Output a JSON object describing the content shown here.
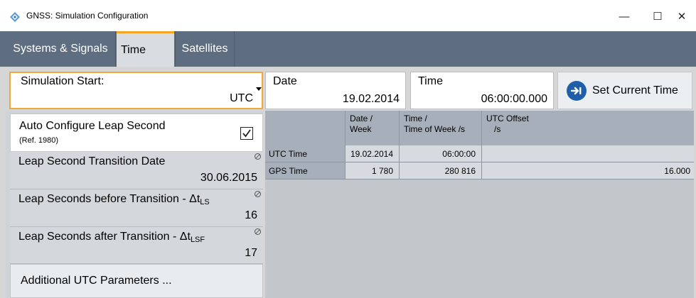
{
  "window": {
    "title": "GNSS: Simulation Configuration",
    "controls": {
      "minimize": "—",
      "maximize": "☐",
      "close": "✕"
    }
  },
  "tabs": [
    {
      "label": "Systems & Signals",
      "active": false
    },
    {
      "label": "Time",
      "active": true
    },
    {
      "label": "Satellites",
      "active": false
    }
  ],
  "simulation_start": {
    "label": "Simulation Start:",
    "value": "UTC"
  },
  "date": {
    "label": "Date",
    "value": "19.02.2014"
  },
  "time": {
    "label": "Time",
    "value": "06:00:00.000"
  },
  "set_current_time": {
    "label": "Set Current Time",
    "icon": "arrow-right-circle-icon"
  },
  "auto_configure": {
    "label": "Auto Configure Leap Second",
    "ref": "(Ref. 1980)",
    "checked": true
  },
  "leap_transition_date": {
    "label": "Leap Second Transition Date",
    "value": "30.06.2015"
  },
  "leap_before": {
    "label": "Leap Seconds before Transition - Δt",
    "sub": "LS",
    "value": "16"
  },
  "leap_after": {
    "label": "Leap Seconds after Transition - Δt",
    "sub": "LSF",
    "value": "17"
  },
  "additional_utc": {
    "label": "Additional UTC Parameters ..."
  },
  "table": {
    "headers": {
      "date_line1": "Date /",
      "date_line2": "Week",
      "time_line1": "Time /",
      "time_line2": "Time of Week /s",
      "utc_line1": "UTC Offset",
      "utc_line2": "/s"
    },
    "rows": [
      {
        "name": "UTC Time",
        "date": "19.02.2014",
        "time": "06:00:00",
        "utc": ""
      },
      {
        "name": "GPS Time",
        "date": "1 780",
        "time": "280 816",
        "utc": "16.000"
      }
    ]
  },
  "colors": {
    "accent": "#f5a623",
    "tab_bar": "#5e6e80",
    "icon_blue": "#1f5ea8"
  }
}
